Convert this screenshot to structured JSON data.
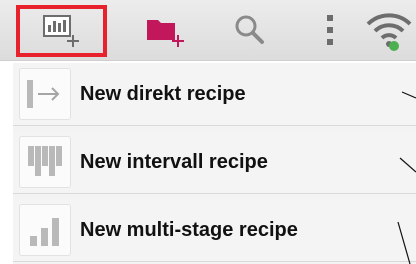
{
  "toolbar": {
    "buttons": [
      {
        "name": "new-recipe-icon",
        "highlighted": true
      },
      {
        "name": "new-folder-icon"
      },
      {
        "name": "search-icon"
      },
      {
        "name": "overflow-menu-icon"
      },
      {
        "name": "wifi-icon"
      }
    ],
    "highlight_color": "#e8222d",
    "folder_color": "#c2185b",
    "wifi_badge_color": "#4caf50"
  },
  "menu": {
    "items": [
      {
        "label": "New direkt recipe",
        "icon": "direct-recipe-icon"
      },
      {
        "label": "New intervall recipe",
        "icon": "interval-recipe-icon"
      },
      {
        "label": "New multi-stage recipe",
        "icon": "multi-stage-recipe-icon"
      }
    ]
  }
}
